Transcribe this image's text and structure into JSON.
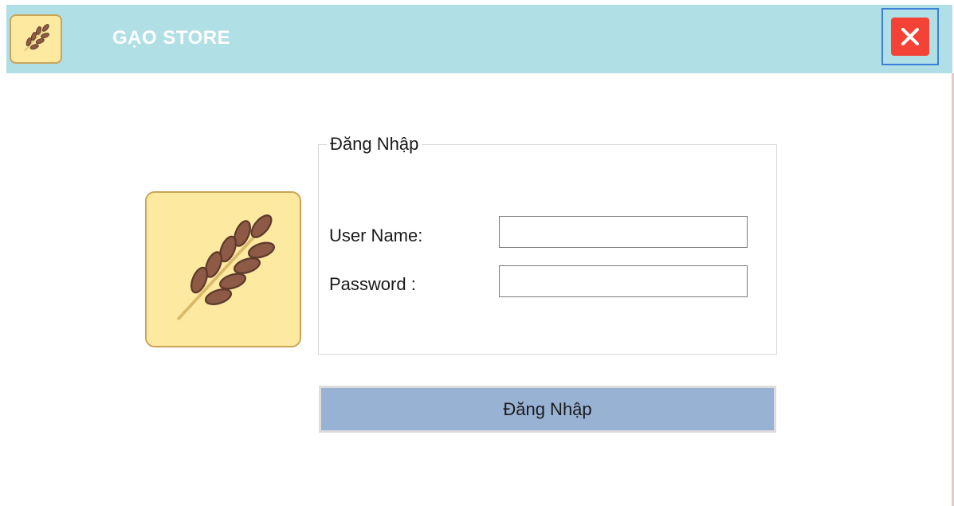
{
  "window": {
    "title": "GẠO STORE",
    "app_icon": "wheat-icon",
    "close_icon": "close-icon"
  },
  "login": {
    "group_title": "Đăng Nhập",
    "username_label": "User Name:",
    "username_value": "",
    "password_label": "Password :",
    "password_value": "",
    "submit_label": "Đăng Nhập"
  },
  "logo": {
    "icon": "wheat-icon"
  },
  "colors": {
    "titlebar": "#b0dfe6",
    "logo_bg": "#fde9a0",
    "grain": "#8d5a45",
    "close": "#f44336",
    "button": "#98b2d4"
  }
}
